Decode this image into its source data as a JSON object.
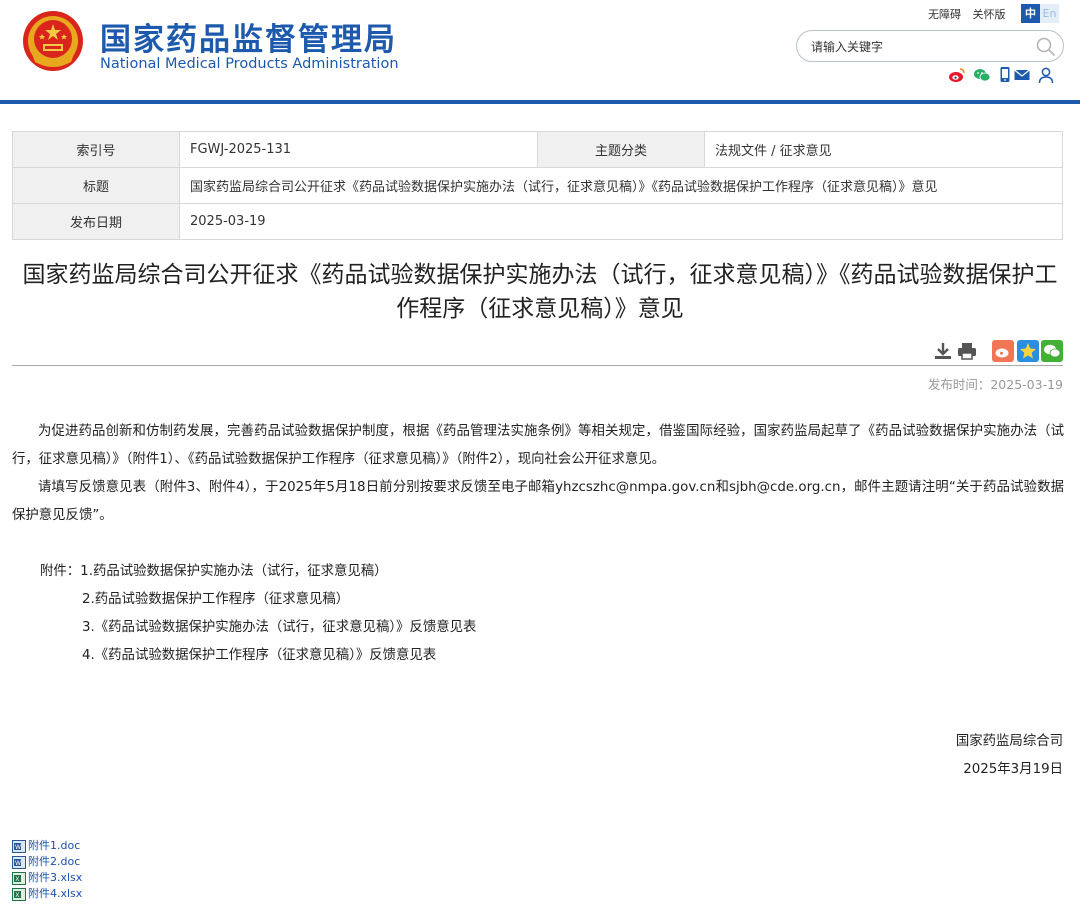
{
  "header": {
    "site_name_cn": "国家药品监督管理局",
    "site_name_en": "National Medical Products Administration",
    "accessibility_link": "无障碍",
    "elder_mode_link": "关怀版",
    "lang_zh": "中",
    "lang_en": "En",
    "search_placeholder": "请输入关键字",
    "brand_color": "#1d5aad",
    "social_icons": [
      "weibo-icon",
      "wechat-icon",
      "mobile-icon",
      "mail-icon",
      "user-icon"
    ]
  },
  "meta": {
    "index_label": "索引号",
    "index_value": "FGWJ-2025-131",
    "category_label": "主题分类",
    "category_value": "法规文件 / 征求意见",
    "title_label": "标题",
    "title_value": "国家药监局综合司公开征求《药品试验数据保护实施办法（试行，征求意见稿）》《药品试验数据保护工作程序（征求意见稿）》意见",
    "date_label": "发布日期",
    "date_value": "2025-03-19"
  },
  "article": {
    "title": "国家药监局综合司公开征求《药品试验数据保护实施办法（试行，征求意见稿）》《药品试验数据保护工作程序（征求意见稿）》意见",
    "publish_time": "发布时间：2025-03-19",
    "paragraphs": [
      "为促进药品创新和仿制药发展，完善药品试验数据保护制度，根据《药品管理法实施条例》等相关规定，借鉴国际经验，国家药监局起草了《药品试验数据保护实施办法（试行，征求意见稿）》（附件1）、《药品试验数据保护工作程序（征求意见稿）》（附件2），现向社会公开征求意见。",
      "请填写反馈意见表（附件3、附件4），于2025年5月18日前分别按要求反馈至电子邮箱yhzcszhc@nmpa.gov.cn和sjbh@cde.org.cn，邮件主题请注明“关于药品试验数据保护意见反馈”。"
    ],
    "attachments_prefix": "附件：",
    "attachments": [
      "1.药品试验数据保护实施办法（试行，征求意见稿）",
      "2.药品试验数据保护工作程序（征求意见稿）",
      "3.《药品试验数据保护实施办法（试行，征求意见稿）》反馈意见表",
      "4.《药品试验数据保护工作程序（征求意见稿）》反馈意见表"
    ],
    "signature_org": "国家药监局综合司",
    "signature_date": "2025年3月19日"
  },
  "files": [
    {
      "name": "附件1.doc",
      "icon": "word-file-icon"
    },
    {
      "name": "附件2.doc",
      "icon": "word-file-icon"
    },
    {
      "name": "附件3.xlsx",
      "icon": "excel-file-icon"
    },
    {
      "name": "附件4.xlsx",
      "icon": "excel-file-icon"
    }
  ]
}
